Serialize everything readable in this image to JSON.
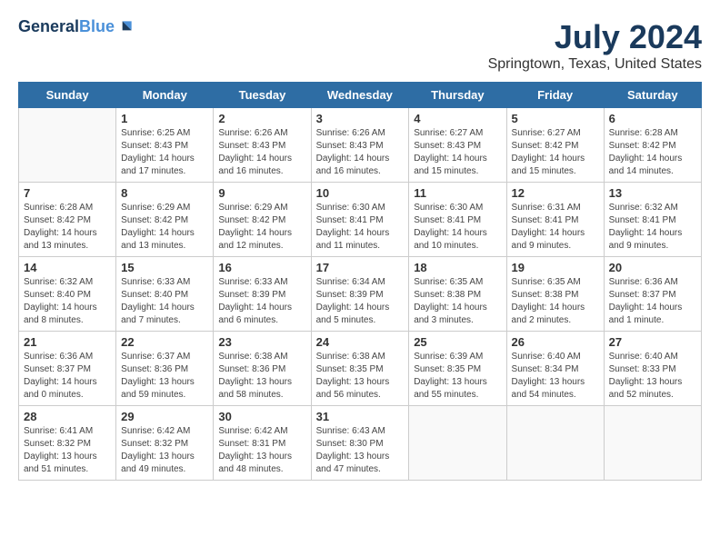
{
  "header": {
    "logo_line1": "General",
    "logo_line2": "Blue",
    "month_title": "July 2024",
    "location": "Springtown, Texas, United States"
  },
  "days_of_week": [
    "Sunday",
    "Monday",
    "Tuesday",
    "Wednesday",
    "Thursday",
    "Friday",
    "Saturday"
  ],
  "weeks": [
    [
      {
        "day": "",
        "info": ""
      },
      {
        "day": "1",
        "info": "Sunrise: 6:25 AM\nSunset: 8:43 PM\nDaylight: 14 hours\nand 17 minutes."
      },
      {
        "day": "2",
        "info": "Sunrise: 6:26 AM\nSunset: 8:43 PM\nDaylight: 14 hours\nand 16 minutes."
      },
      {
        "day": "3",
        "info": "Sunrise: 6:26 AM\nSunset: 8:43 PM\nDaylight: 14 hours\nand 16 minutes."
      },
      {
        "day": "4",
        "info": "Sunrise: 6:27 AM\nSunset: 8:43 PM\nDaylight: 14 hours\nand 15 minutes."
      },
      {
        "day": "5",
        "info": "Sunrise: 6:27 AM\nSunset: 8:42 PM\nDaylight: 14 hours\nand 15 minutes."
      },
      {
        "day": "6",
        "info": "Sunrise: 6:28 AM\nSunset: 8:42 PM\nDaylight: 14 hours\nand 14 minutes."
      }
    ],
    [
      {
        "day": "7",
        "info": "Sunrise: 6:28 AM\nSunset: 8:42 PM\nDaylight: 14 hours\nand 13 minutes."
      },
      {
        "day": "8",
        "info": "Sunrise: 6:29 AM\nSunset: 8:42 PM\nDaylight: 14 hours\nand 13 minutes."
      },
      {
        "day": "9",
        "info": "Sunrise: 6:29 AM\nSunset: 8:42 PM\nDaylight: 14 hours\nand 12 minutes."
      },
      {
        "day": "10",
        "info": "Sunrise: 6:30 AM\nSunset: 8:41 PM\nDaylight: 14 hours\nand 11 minutes."
      },
      {
        "day": "11",
        "info": "Sunrise: 6:30 AM\nSunset: 8:41 PM\nDaylight: 14 hours\nand 10 minutes."
      },
      {
        "day": "12",
        "info": "Sunrise: 6:31 AM\nSunset: 8:41 PM\nDaylight: 14 hours\nand 9 minutes."
      },
      {
        "day": "13",
        "info": "Sunrise: 6:32 AM\nSunset: 8:41 PM\nDaylight: 14 hours\nand 9 minutes."
      }
    ],
    [
      {
        "day": "14",
        "info": "Sunrise: 6:32 AM\nSunset: 8:40 PM\nDaylight: 14 hours\nand 8 minutes."
      },
      {
        "day": "15",
        "info": "Sunrise: 6:33 AM\nSunset: 8:40 PM\nDaylight: 14 hours\nand 7 minutes."
      },
      {
        "day": "16",
        "info": "Sunrise: 6:33 AM\nSunset: 8:39 PM\nDaylight: 14 hours\nand 6 minutes."
      },
      {
        "day": "17",
        "info": "Sunrise: 6:34 AM\nSunset: 8:39 PM\nDaylight: 14 hours\nand 5 minutes."
      },
      {
        "day": "18",
        "info": "Sunrise: 6:35 AM\nSunset: 8:38 PM\nDaylight: 14 hours\nand 3 minutes."
      },
      {
        "day": "19",
        "info": "Sunrise: 6:35 AM\nSunset: 8:38 PM\nDaylight: 14 hours\nand 2 minutes."
      },
      {
        "day": "20",
        "info": "Sunrise: 6:36 AM\nSunset: 8:37 PM\nDaylight: 14 hours\nand 1 minute."
      }
    ],
    [
      {
        "day": "21",
        "info": "Sunrise: 6:36 AM\nSunset: 8:37 PM\nDaylight: 14 hours\nand 0 minutes."
      },
      {
        "day": "22",
        "info": "Sunrise: 6:37 AM\nSunset: 8:36 PM\nDaylight: 13 hours\nand 59 minutes."
      },
      {
        "day": "23",
        "info": "Sunrise: 6:38 AM\nSunset: 8:36 PM\nDaylight: 13 hours\nand 58 minutes."
      },
      {
        "day": "24",
        "info": "Sunrise: 6:38 AM\nSunset: 8:35 PM\nDaylight: 13 hours\nand 56 minutes."
      },
      {
        "day": "25",
        "info": "Sunrise: 6:39 AM\nSunset: 8:35 PM\nDaylight: 13 hours\nand 55 minutes."
      },
      {
        "day": "26",
        "info": "Sunrise: 6:40 AM\nSunset: 8:34 PM\nDaylight: 13 hours\nand 54 minutes."
      },
      {
        "day": "27",
        "info": "Sunrise: 6:40 AM\nSunset: 8:33 PM\nDaylight: 13 hours\nand 52 minutes."
      }
    ],
    [
      {
        "day": "28",
        "info": "Sunrise: 6:41 AM\nSunset: 8:32 PM\nDaylight: 13 hours\nand 51 minutes."
      },
      {
        "day": "29",
        "info": "Sunrise: 6:42 AM\nSunset: 8:32 PM\nDaylight: 13 hours\nand 49 minutes."
      },
      {
        "day": "30",
        "info": "Sunrise: 6:42 AM\nSunset: 8:31 PM\nDaylight: 13 hours\nand 48 minutes."
      },
      {
        "day": "31",
        "info": "Sunrise: 6:43 AM\nSunset: 8:30 PM\nDaylight: 13 hours\nand 47 minutes."
      },
      {
        "day": "",
        "info": ""
      },
      {
        "day": "",
        "info": ""
      },
      {
        "day": "",
        "info": ""
      }
    ]
  ]
}
